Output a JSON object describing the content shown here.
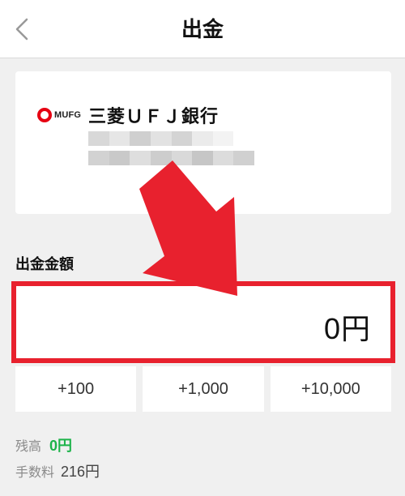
{
  "header": {
    "title": "出金",
    "back_icon": "chevron-left-icon"
  },
  "bank": {
    "logo_text": "MUFG",
    "name": "三菱ＵＦＪ銀行",
    "account_redacted": true
  },
  "withdrawal": {
    "section_label": "出金金額",
    "amount": "0円",
    "quick_add": [
      "+100",
      "+1,000",
      "+10,000"
    ]
  },
  "info": {
    "balance_label": "残高",
    "balance_value": "0円",
    "fee_label": "手数料",
    "fee_value": "216円"
  },
  "colors": {
    "highlight_red": "#e8212e",
    "balance_green": "#1db34a",
    "mufg_red": "#e60012"
  }
}
